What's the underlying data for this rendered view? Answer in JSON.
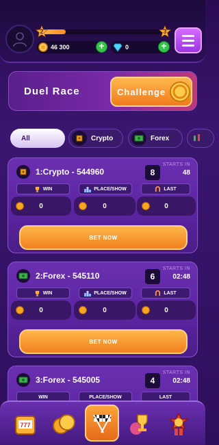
{
  "header": {
    "level_current": "2",
    "level_next": "3",
    "level_progress_fraction": 0.2,
    "coins": "46 300",
    "gems": "0",
    "icons": [
      "avatar-icon",
      "coin-icon",
      "gem-icon",
      "add-icon",
      "menu-icon"
    ]
  },
  "banner": {
    "title": "Duel Race",
    "challenge_label": "Challenge"
  },
  "tabs": [
    {
      "label": "All",
      "selected": true
    },
    {
      "label": "Crypto",
      "selected": false
    },
    {
      "label": "Forex",
      "selected": false
    }
  ],
  "columns": {
    "win": "WIN",
    "place_show": "PLACE/SHOW",
    "last": "LAST"
  },
  "races": [
    {
      "title": "1:Crypto - 544960",
      "number": "8",
      "starts_label": "STARTS IN",
      "starts_in": "48",
      "win": "0",
      "place_show": "0",
      "last": "0",
      "bet_label": "BET NOW",
      "icon": "crypto-chip-icon"
    },
    {
      "title": "2:Forex - 545110",
      "number": "6",
      "starts_label": "STARTS IN",
      "starts_in": "02:48",
      "win": "0",
      "place_show": "0",
      "last": "0",
      "bet_label": "BET NOW",
      "icon": "forex-money-icon"
    },
    {
      "title": "3:Forex - 545005",
      "number": "4",
      "starts_label": "STARTS IN",
      "starts_in": "02:48",
      "win": "",
      "place_show": "",
      "last": "",
      "bet_label": "",
      "icon": "forex-money-icon"
    }
  ],
  "bottom_nav": [
    {
      "name": "slots-icon",
      "active": false
    },
    {
      "name": "coins-icon",
      "active": false
    },
    {
      "name": "race-flags-icon",
      "active": true
    },
    {
      "name": "trophy-icon",
      "active": false
    },
    {
      "name": "medal-icon",
      "active": false
    }
  ],
  "colors": {
    "background": "#2e0f5c",
    "card": "#5a24a0",
    "accent_orange": "#f0801f",
    "plus_green": "#33c548"
  }
}
